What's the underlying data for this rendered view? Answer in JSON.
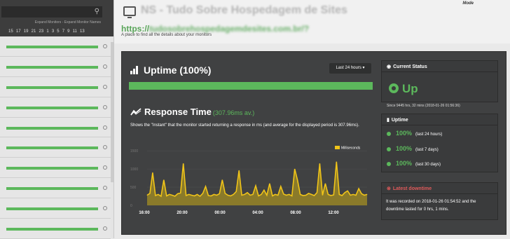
{
  "sidebar": {
    "links": "Expand Monitors - Expand Monitor Names",
    "days": [
      "15",
      "17",
      "19",
      "21",
      "23",
      "1",
      "3",
      "5",
      "7",
      "9",
      "11",
      "13"
    ],
    "row_count": 10
  },
  "header": {
    "title": "NS - Tudo Sobre Hospedagem de Sites",
    "url_prefix": "https://",
    "url_blurred": "tudosobrehospedagemdesites.com.br/?",
    "subtitle": "A place to find all the details about your monitors",
    "mode": "Mode"
  },
  "uptime": {
    "title": "Uptime (100%)",
    "range": "Last 24 hours ▾",
    "bar_fraction": 1.0
  },
  "response": {
    "title": "Response Time",
    "avg": "(307.96ms av.)",
    "description": "Shows the \"Instant\" that the monitor started returning a response in ms (and average for the displayed period is 307.96ms).",
    "legend": "Milliseconds",
    "x_ticks": [
      "16:00",
      "20:00",
      "00:00",
      "04:00",
      "08:00",
      "12:00"
    ],
    "y_ticks": [
      "1500",
      "1000",
      "500",
      "0"
    ]
  },
  "chart_data": {
    "type": "area",
    "series": [
      {
        "name": "Milliseconds",
        "values": [
          280,
          330,
          900,
          270,
          300,
          250,
          700,
          260,
          300,
          280,
          250,
          320,
          340,
          1150,
          270,
          300,
          280,
          260,
          300,
          250,
          330,
          520,
          270,
          260,
          300,
          280,
          320,
          700,
          330,
          280,
          260,
          300,
          380,
          960,
          280,
          300,
          350,
          280,
          300,
          540,
          260,
          300,
          420,
          280,
          600,
          260,
          300,
          280,
          520,
          310,
          280,
          300,
          260,
          1000,
          700,
          300,
          270,
          280,
          330,
          300,
          270,
          350,
          1150,
          280,
          600,
          300,
          270,
          290,
          1200,
          300,
          270,
          350,
          400,
          280,
          300,
          280,
          460,
          320,
          280,
          300
        ]
      }
    ],
    "ylim": [
      0,
      1600
    ],
    "xlabel": "",
    "ylabel": "",
    "colors": {
      "line": "#f0c419",
      "fill": "#8a7a2a"
    }
  },
  "status": {
    "title": "Current Status",
    "value": "Up",
    "since": "Since 9445 hrs, 32 mins (2018-01-26 01:56:36)"
  },
  "uptime_widget": {
    "title": "Uptime",
    "rows": [
      {
        "pct": "100%",
        "label": "(last 24 hours)"
      },
      {
        "pct": "100%",
        "label": "(last 7 days)"
      },
      {
        "pct": "100%",
        "label": "(last 30 days)"
      }
    ]
  },
  "downtime": {
    "title": "Latest downtime",
    "text": "It was recorded on 2018-01-26 01:54:52 and the downtime lasted for 0 hrs, 1 mins."
  },
  "colors": {
    "accent": "#5cb85c",
    "alert": "#e05a5a",
    "panel": "#404142"
  }
}
